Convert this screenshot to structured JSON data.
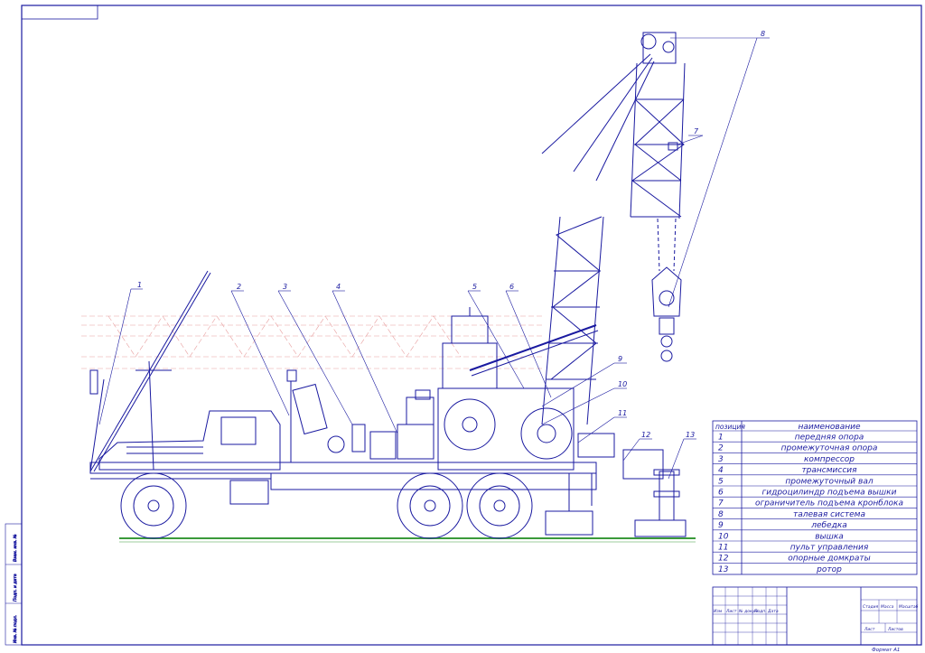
{
  "colors": {
    "ink": "#1a1aa0",
    "ground": "#3a9a3a",
    "ghost": "#e8a0a0"
  },
  "parts_table": {
    "header": {
      "pos": "позиция",
      "name": "наименование"
    },
    "rows": [
      {
        "pos": "1",
        "name": "передняя опора"
      },
      {
        "pos": "2",
        "name": "промежуточная опора"
      },
      {
        "pos": "3",
        "name": "компрессор"
      },
      {
        "pos": "4",
        "name": "трансмиссия"
      },
      {
        "pos": "5",
        "name": "промежуточный вал"
      },
      {
        "pos": "6",
        "name": "гидроцилиндр подъема вышки"
      },
      {
        "pos": "7",
        "name": "ограничитель подъема кронблока"
      },
      {
        "pos": "8",
        "name": "талевая система"
      },
      {
        "pos": "9",
        "name": "лебедка"
      },
      {
        "pos": "10",
        "name": "вышка"
      },
      {
        "pos": "11",
        "name": "пульт управления"
      },
      {
        "pos": "12",
        "name": "опорные домкраты"
      },
      {
        "pos": "13",
        "name": "ротор"
      }
    ]
  },
  "callouts": [
    "1",
    "2",
    "3",
    "4",
    "5",
    "6",
    "7",
    "8",
    "9",
    "10",
    "11",
    "12",
    "13"
  ],
  "title_block": {
    "col_labels": [
      "Изм",
      "Лист",
      "№ докум.",
      "Подп.",
      "Дата"
    ],
    "stage_label": "Стадия",
    "mass_label": "Масса",
    "scale_label": "Масштаб",
    "sheet_label": "Лист",
    "sheets_label": "Листов"
  },
  "format_note": "Формат А1",
  "side_stamp": [
    "Инв. № подл.",
    "Подп. и дата",
    "Взам. инв. №"
  ]
}
